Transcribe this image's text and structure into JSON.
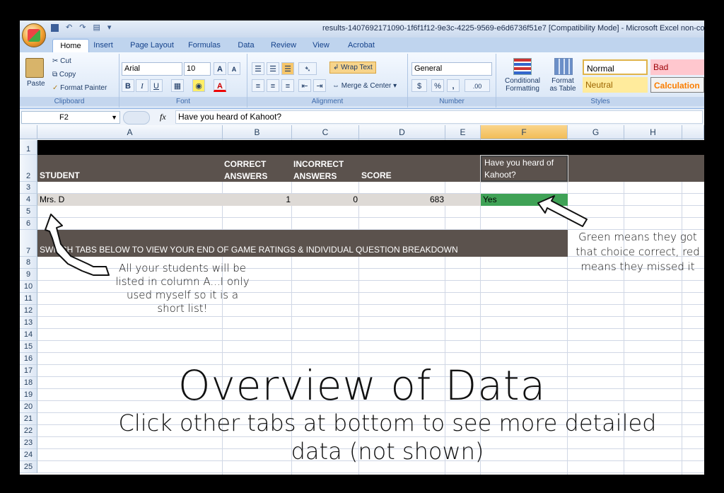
{
  "window": {
    "title": "results-1407692171090-1f6f1f12-9e3c-4225-9569-e6d6736f51e7  [Compatibility Mode] - Microsoft Excel non-com"
  },
  "ribbon_tabs": [
    "Home",
    "Insert",
    "Page Layout",
    "Formulas",
    "Data",
    "Review",
    "View",
    "Acrobat"
  ],
  "clipboard": {
    "paste": "Paste",
    "cut": "Cut",
    "copy": "Copy",
    "format_painter": "Format Painter",
    "label": "Clipboard"
  },
  "font": {
    "name": "Arial",
    "size": "10",
    "grow": "A",
    "shrink": "A",
    "bold": "B",
    "italic": "I",
    "underline": "U",
    "color_glyph": "A",
    "label": "Font"
  },
  "alignment": {
    "wrap": "Wrap Text",
    "merge": "Merge & Center",
    "label": "Alignment"
  },
  "number": {
    "format": "General",
    "currency": "$",
    "percent": "%",
    "comma": ",",
    "inc_dec": ".00",
    "label": "Number"
  },
  "styles": {
    "conditional": [
      "Conditional",
      "Formatting"
    ],
    "format_table": [
      "Format",
      "as Table"
    ],
    "normal": "Normal",
    "bad": "Bad",
    "neutral": "Neutral",
    "calculation": "Calculation",
    "label": "Styles"
  },
  "formula_bar": {
    "name_box": "F2",
    "fx": "fx",
    "content": "Have you heard of Kahoot?"
  },
  "columns": [
    "A",
    "B",
    "C",
    "D",
    "E",
    "F",
    "G",
    "H"
  ],
  "rows": [
    "1",
    "2",
    "3",
    "4",
    "5",
    "6",
    "7",
    "8",
    "9",
    "10",
    "11",
    "12",
    "13",
    "14",
    "15",
    "16",
    "17",
    "18",
    "19",
    "20",
    "21",
    "22",
    "23",
    "24",
    "25"
  ],
  "sheet": {
    "headers": {
      "student": "STUDENT",
      "correct": [
        "CORRECT",
        "ANSWERS"
      ],
      "incorrect": [
        "INCORRECT",
        "ANSWERS"
      ],
      "score": "SCORE",
      "question": [
        "Have you heard of",
        "Kahoot?"
      ]
    },
    "row4": {
      "student": "Mrs. D",
      "correct": "1",
      "incorrect": "0",
      "score": "683",
      "answer": "Yes"
    },
    "row7": "SWITCH TABS BELOW TO VIEW YOUR END OF GAME RATINGS & INDIVIDUAL QUESTION BREAKDOWN"
  },
  "annotations": {
    "left_note": [
      "All your students will be",
      "listed in column A...I only",
      "used myself so it is a",
      "short list!"
    ],
    "right_note": [
      "Green means they got",
      "that choice correct, red",
      "means they missed it"
    ],
    "big_title": "Overview of Data",
    "subtitle_line1": "Click other tabs at bottom to see more detailed",
    "subtitle_line2": "data (not shown)"
  },
  "colors": {
    "header_band": "#5b524d",
    "black_band": "#000000",
    "green_cell": "#3fa256",
    "row4_fill": "#dedad6",
    "selected_col": "#f5c462"
  }
}
